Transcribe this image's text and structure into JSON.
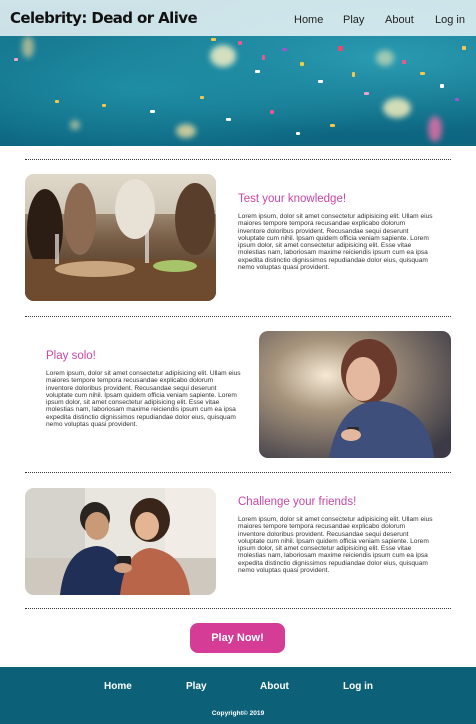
{
  "header": {
    "logo": "Celebrity: Dead or Alive",
    "nav": [
      "Home",
      "Play",
      "About",
      "Log in"
    ]
  },
  "sections": [
    {
      "title": "Test your knowledge!",
      "image": "friends-dinner-party-photo",
      "body": "Lorem ipsum, dolor sit amet consectetur adipisicing elit. Ullam eius maiores tempore tempora recusandae explicabo dolorum inventore doloribus provident. Recusandae sequi deserunt voluptate cum nihil. Ipsam quidem officia veniam sapiente. Lorem ipsum dolor, sit amet consectetur adipisicing elit. Esse vitae molestias nam, laboriosam maxime reiciendis ipsum cum ea ipsa expedita distinctio dignissimos repudiandae dolor eius, quisquam nemo voluptas quasi provident."
    },
    {
      "title": "Play solo!",
      "image": "woman-with-phone-photo",
      "body": "Lorem ipsum, dolor sit amet consectetur adipisicing elit. Ullam eius maiores tempore tempora recusandae explicabo dolorum inventore doloribus provident. Recusandae sequi deserunt voluptate cum nihil. Ipsam quidem officia veniam sapiente. Lorem ipsum dolor, sit amet consectetur adipisicing elit. Esse vitae molestias nam, laboriosam maxime reiciendis ipsum cum ea ipsa expedita distinctio dignissimos repudiandae dolor eius, quisquam nemo voluptas quasi provident."
    },
    {
      "title": "Challenge your friends!",
      "image": "couple-with-phones-photo",
      "body": "Lorem ipsum, dolor sit amet consectetur adipisicing elit. Ullam eius maiores tempore tempora recusandae explicabo dolorum inventore doloribus provident. Recusandae sequi deserunt voluptate cum nihil. Ipsam quidem officia veniam sapiente. Lorem ipsum dolor, sit amet consectetur adipisicing elit. Esse vitae molestias nam, laboriosam maxime reiciendis ipsum cum ea ipsa expedita distinctio dignissimos repudiandae dolor eius, quisquam nemo voluptas quasi provident."
    }
  ],
  "cta": {
    "label": "Play Now!"
  },
  "footer": {
    "nav": [
      "Home",
      "Play",
      "About",
      "Log in"
    ],
    "copyright": "Copyright© 2019"
  },
  "colors": {
    "accent": "#d43c95",
    "title": "#c447a9",
    "footer": "#0c6179",
    "hero": "#0f6d86"
  }
}
